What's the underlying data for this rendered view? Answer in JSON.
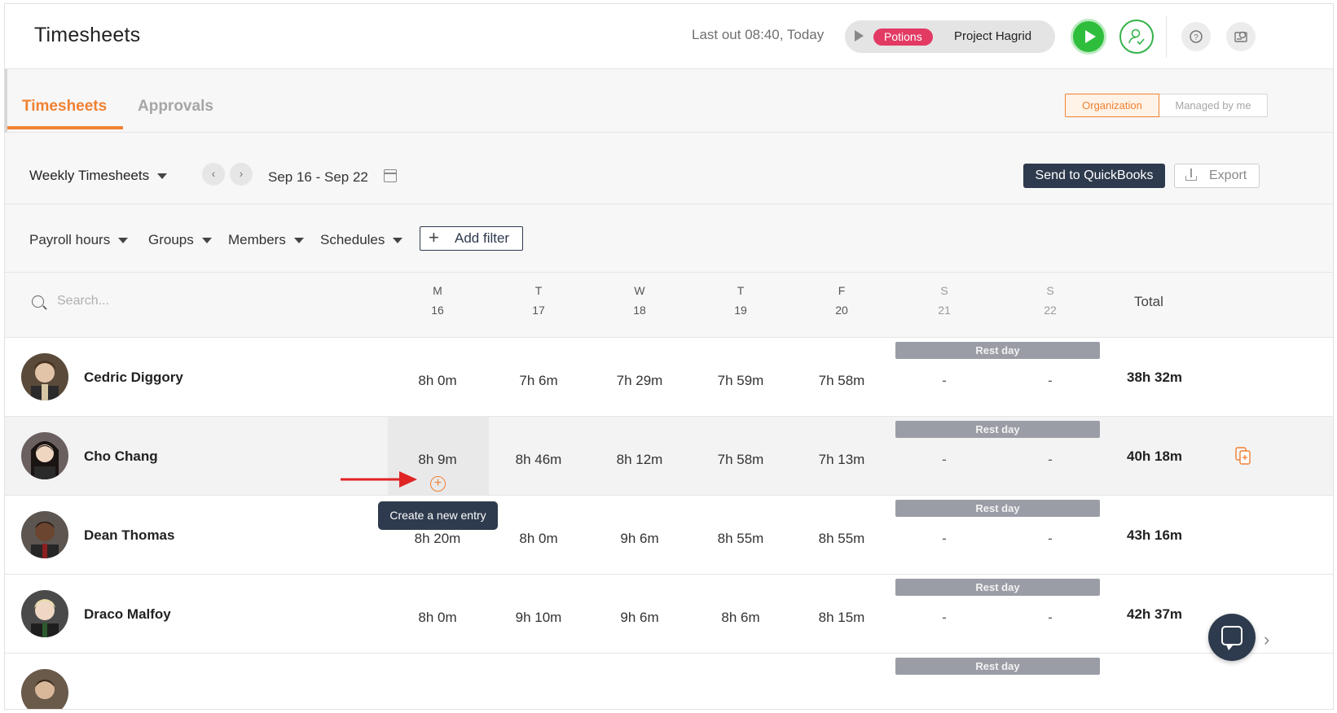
{
  "header": {
    "title": "Timesheets",
    "last_out": "Last out 08:40, Today",
    "timer": {
      "tag": "Potions",
      "tag_color": "#e33a64",
      "project": "Project Hagrid"
    },
    "icons": [
      "play-icon",
      "user-check-icon",
      "help-icon",
      "settings-icon"
    ]
  },
  "tabs": [
    {
      "label": "Timesheets",
      "active": true
    },
    {
      "label": "Approvals",
      "active": false
    }
  ],
  "scope": {
    "options": [
      "Organization",
      "Managed by me"
    ],
    "selected": "Organization"
  },
  "toolbar": {
    "view": "Weekly Timesheets",
    "date_range": "Sep 16 - Sep 22",
    "prev": "‹",
    "next": "›",
    "send_button": "Send to QuickBooks",
    "export_button": "Export"
  },
  "filters": {
    "items": [
      "Payroll hours",
      "Groups",
      "Members",
      "Schedules"
    ],
    "add_filter": "Add filter"
  },
  "table": {
    "search_placeholder": "Search...",
    "days": [
      {
        "letter": "M",
        "date": "16"
      },
      {
        "letter": "T",
        "date": "17"
      },
      {
        "letter": "W",
        "date": "18"
      },
      {
        "letter": "T",
        "date": "19"
      },
      {
        "letter": "F",
        "date": "20"
      },
      {
        "letter": "S",
        "date": "21"
      },
      {
        "letter": "S",
        "date": "22"
      }
    ],
    "total_label": "Total",
    "rest_day_label": "Rest day",
    "rows": [
      {
        "name": "Cedric Diggory",
        "hours": [
          "8h 0m",
          "7h 6m",
          "7h 29m",
          "7h 59m",
          "7h 58m",
          "-",
          "-"
        ],
        "total": "38h 32m"
      },
      {
        "name": "Cho Chang",
        "hours": [
          "8h 9m",
          "8h 46m",
          "8h 12m",
          "7h 58m",
          "7h 13m",
          "-",
          "-"
        ],
        "total": "40h 18m"
      },
      {
        "name": "Dean Thomas",
        "hours": [
          "8h 20m",
          "8h 0m",
          "9h 6m",
          "8h 55m",
          "8h 55m",
          "-",
          "-"
        ],
        "total": "43h 16m"
      },
      {
        "name": "Draco Malfoy",
        "hours": [
          "8h 0m",
          "9h 10m",
          "9h 6m",
          "8h 6m",
          "8h 15m",
          "-",
          "-"
        ],
        "total": "42h 37m"
      }
    ]
  },
  "tooltip": "Create a new entry",
  "colors": {
    "accent": "#f08132",
    "primary_dark": "#2e3a4d",
    "start_green": "#2fbe3c",
    "rest_day": "#9a9da5"
  }
}
